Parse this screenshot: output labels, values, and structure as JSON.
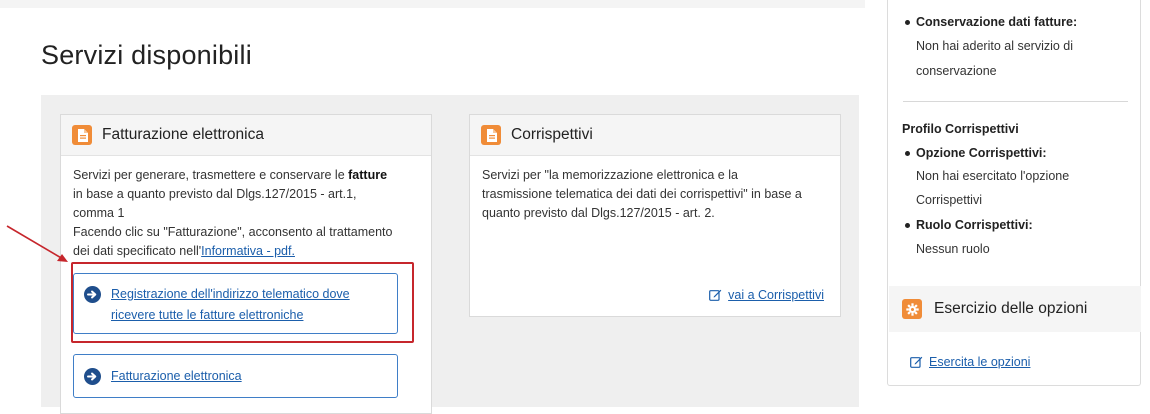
{
  "page_title": "Servizi disponibili",
  "fatturazione_card": {
    "title": "Fatturazione elettronica",
    "icon": "document-icon",
    "desc_line1_a": "Servizi per generare, trasmettere e conservare le ",
    "desc_line1_b": "fatture",
    "desc_line2": "in base a quanto previsto dal Dlgs.127/2015 - art.1,",
    "desc_line3": "comma 1",
    "desc_line4": "Facendo clic su \"Fatturazione\", acconsento al trattamento",
    "desc_line5_a": "dei dati specificato nell'",
    "desc_link": "Informativa - pdf.",
    "btn_registrazione_line1": "Registrazione dell'indirizzo telematico dove",
    "btn_registrazione_line2": "ricevere tutte le fatture elettroniche",
    "btn_fatturazione": "Fatturazione elettronica"
  },
  "corrispettivi_card": {
    "title": "Corrispettivi",
    "icon": "document-icon",
    "desc_line1": "Servizi per \"la memorizzazione elettronica e la",
    "desc_line2": "trasmissione telematica dei dati dei corrispettivi\" in base a",
    "desc_line3": "quanto previsto dal Dlgs.127/2015 - art. 2.",
    "link": "vai a Corrispettivi"
  },
  "side_panel": {
    "conservazione_title": "Conservazione dati fatture:",
    "conservazione_line1": "Non hai aderito al servizio di",
    "conservazione_line2": "conservazione",
    "profilo_title": "Profilo Corrispettivi",
    "opzione_title": "Opzione Corrispettivi:",
    "opzione_line1": "Non hai esercitato l'opzione",
    "opzione_line2": "Corrispettivi",
    "ruolo_title": "Ruolo Corrispettivi:",
    "ruolo_value": "Nessun ruolo",
    "esercizio_title": "Esercizio delle opzioni",
    "esercizio_icon": "gear-icon",
    "esercita_link": "Esercita le opzioni"
  },
  "colors": {
    "accent_orange": "#f08c38",
    "link_blue": "#1b5eab",
    "highlight_red": "#c6262c"
  }
}
